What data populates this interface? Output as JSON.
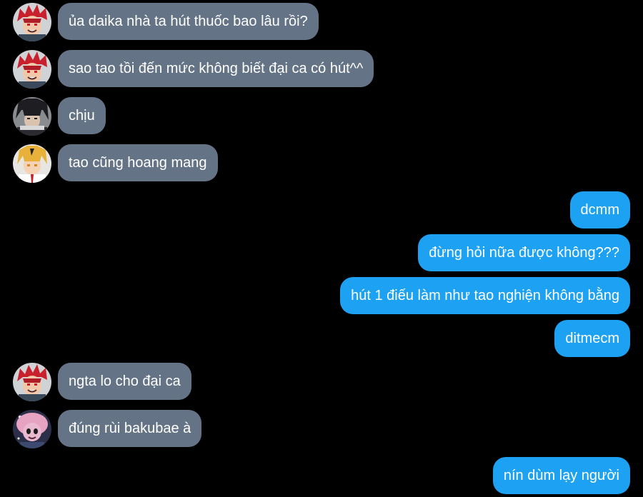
{
  "colors": {
    "background": "#000000",
    "incoming_bubble": "#647486",
    "outgoing_bubble": "#1da1f2",
    "text": "#ffffff"
  },
  "messages": [
    {
      "direction": "incoming",
      "sender_avatar": "red-spiky-hair-avatar",
      "text": "ủa daika nhà ta hút thuốc bao lâu rồi?"
    },
    {
      "direction": "incoming",
      "sender_avatar": "red-spiky-hair-avatar",
      "text": "sao tao tồi đến mức không biết đại ca có hút^^"
    },
    {
      "direction": "incoming",
      "sender_avatar": "dark-hair-avatar",
      "text": "chịu"
    },
    {
      "direction": "incoming",
      "sender_avatar": "blonde-hair-avatar",
      "text": "tao cũng hoang mang"
    },
    {
      "direction": "outgoing",
      "text": "dcmm"
    },
    {
      "direction": "outgoing",
      "text": "đừng hỏi nữa được không???"
    },
    {
      "direction": "outgoing",
      "text": "hút 1 điếu làm như tao nghiện không bằng"
    },
    {
      "direction": "outgoing",
      "text": "ditmecm"
    },
    {
      "direction": "incoming",
      "sender_avatar": "red-spiky-hair-avatar",
      "text": "ngta lo cho đại ca"
    },
    {
      "direction": "incoming",
      "sender_avatar": "pink-hair-avatar",
      "text": "đúng rùi bakubae à"
    },
    {
      "direction": "outgoing",
      "text": "nín dùm lạy người"
    }
  ]
}
